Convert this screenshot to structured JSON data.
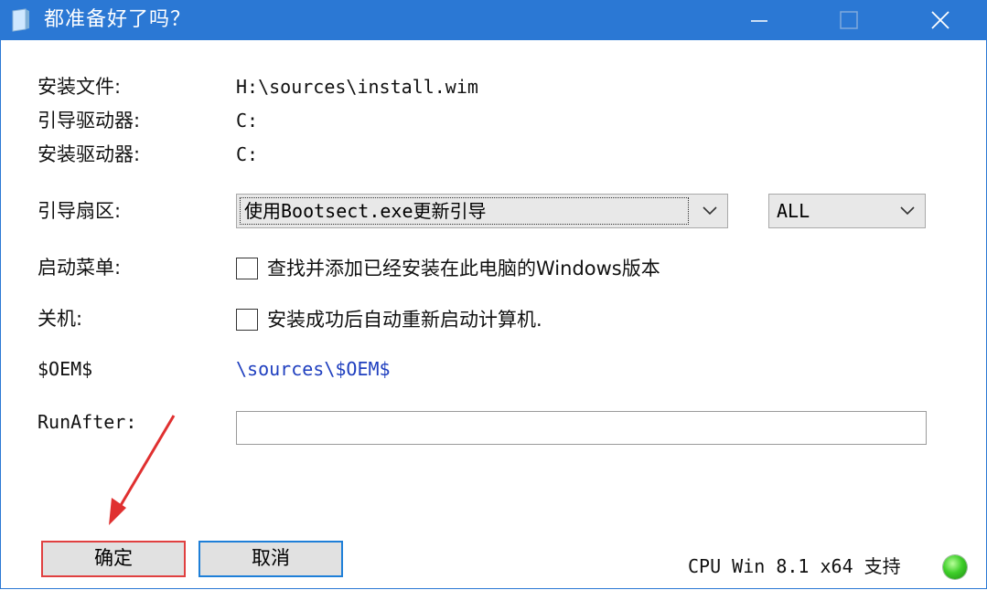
{
  "window": {
    "title": "都准备好了吗？",
    "controls": [
      "minimize",
      "maximize",
      "close"
    ]
  },
  "fields": {
    "install_file_label": "安装文件:",
    "install_file_value": "H:\\sources\\install.wim",
    "boot_drive_label": "引导驱动器:",
    "boot_drive_value": "C:",
    "install_drive_label": "安装驱动器:",
    "install_drive_value": "C:",
    "boot_sector_label": "引导扇区:",
    "boot_sector_selected": "使用Bootsect.exe更新引导",
    "boot_sector_scope_selected": "ALL",
    "boot_menu_label": "启动菜单:",
    "boot_menu_checkbox_label": "查找并添加已经安装在此电脑的Windows版本",
    "boot_menu_checked": false,
    "shutdown_label": "关机:",
    "shutdown_checkbox_label": "安装成功后自动重新启动计算机.",
    "shutdown_checked": false,
    "oem_label": "$OEM$",
    "oem_value": "\\sources\\$OEM$",
    "runafter_label": "RunAfter:",
    "runafter_value": ""
  },
  "buttons": {
    "ok_label": "确定",
    "cancel_label": "取消"
  },
  "status": {
    "text": "CPU Win 8.1 x64 支持",
    "indicator": "green-led"
  },
  "colors": {
    "titlebar": "#2b78d4",
    "oem_value": "#1f3fbf",
    "ok_highlight": "#e04040",
    "cancel_focus": "#1e7fd8",
    "annotation_arrow": "#e03030"
  }
}
